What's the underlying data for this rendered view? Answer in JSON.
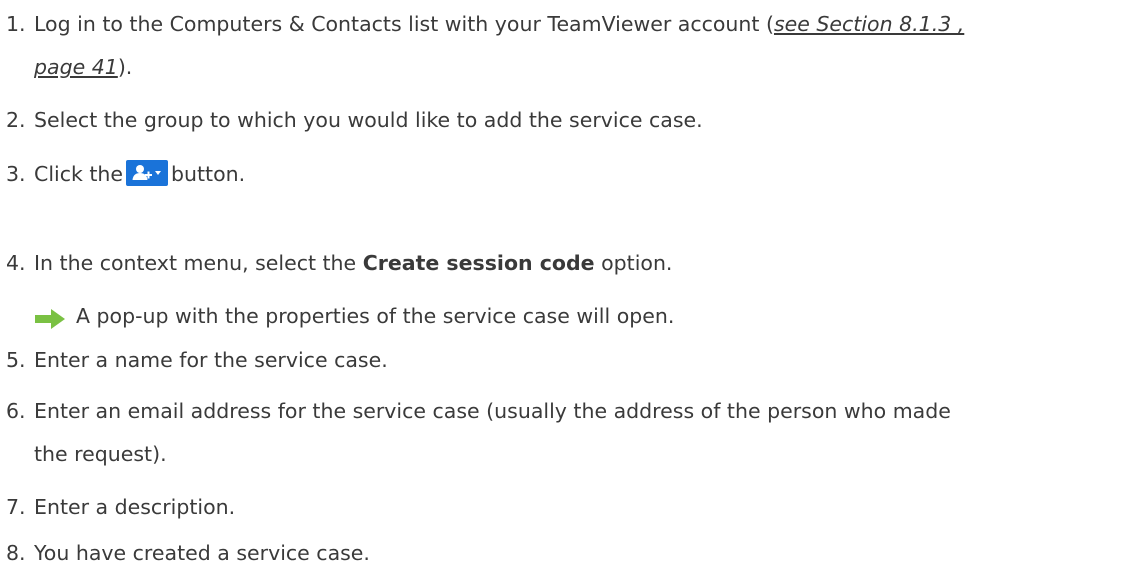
{
  "steps": [
    {
      "num": "1.",
      "text_before": "Log in to the Computers & Contacts list with your TeamViewer account (",
      "link_line1": "see Section 8.1.3 ,",
      "link_line2": "page 41",
      "text_after": ")."
    },
    {
      "num": "2.",
      "text": "Select the group to which you would like to add the service case."
    },
    {
      "num": "3.",
      "text_before": "Click the",
      "text_after": "button."
    },
    {
      "num": "4.",
      "text_before": "In the context menu, select the ",
      "bold": "Create session code",
      "text_after": " option."
    },
    {
      "num": "5.",
      "text": "Enter a name for the service case."
    },
    {
      "num": "6.",
      "text_line1": "Enter an email address for the service case (usually the address of the person who made",
      "text_line2": "the request)."
    },
    {
      "num": "7.",
      "text": "Enter a description."
    },
    {
      "num": "8.",
      "text": "You have created a service case."
    }
  ],
  "result": {
    "text": "A pop-up with the properties of the service case will open.",
    "icon": "green-arrow-icon"
  },
  "button": {
    "icon": "add-contact-dropdown-icon",
    "color": "#1a73d9"
  }
}
